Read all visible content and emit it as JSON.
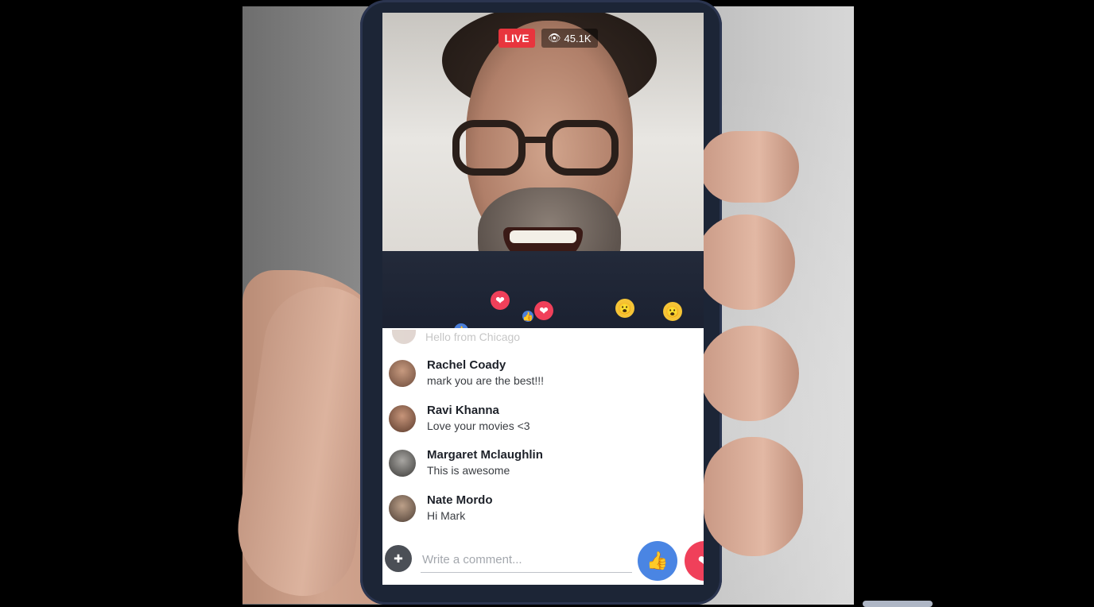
{
  "stream": {
    "live_label": "LIVE",
    "viewers": "45.1K"
  },
  "comments": {
    "faded": "Hello from Chicago",
    "items": [
      {
        "name": "Rachel Coady",
        "text": "mark you are the best!!!"
      },
      {
        "name": "Ravi Khanna",
        "text": "Love your movies <3"
      },
      {
        "name": "Margaret Mclaughlin",
        "text": "This is awesome"
      },
      {
        "name": "Nate Mordo",
        "text": "Hi Mark"
      }
    ]
  },
  "composer": {
    "placeholder": "Write a comment..."
  },
  "icons": {
    "like": "like-icon",
    "love": "love-icon",
    "wow": "wow-icon",
    "viewers": "eye-icon",
    "add_user": "add-friend-icon"
  },
  "colors": {
    "live_red": "#e8353d",
    "like_blue": "#4a85e3",
    "love_red": "#f0405a",
    "wow_yellow": "#f5c436"
  }
}
